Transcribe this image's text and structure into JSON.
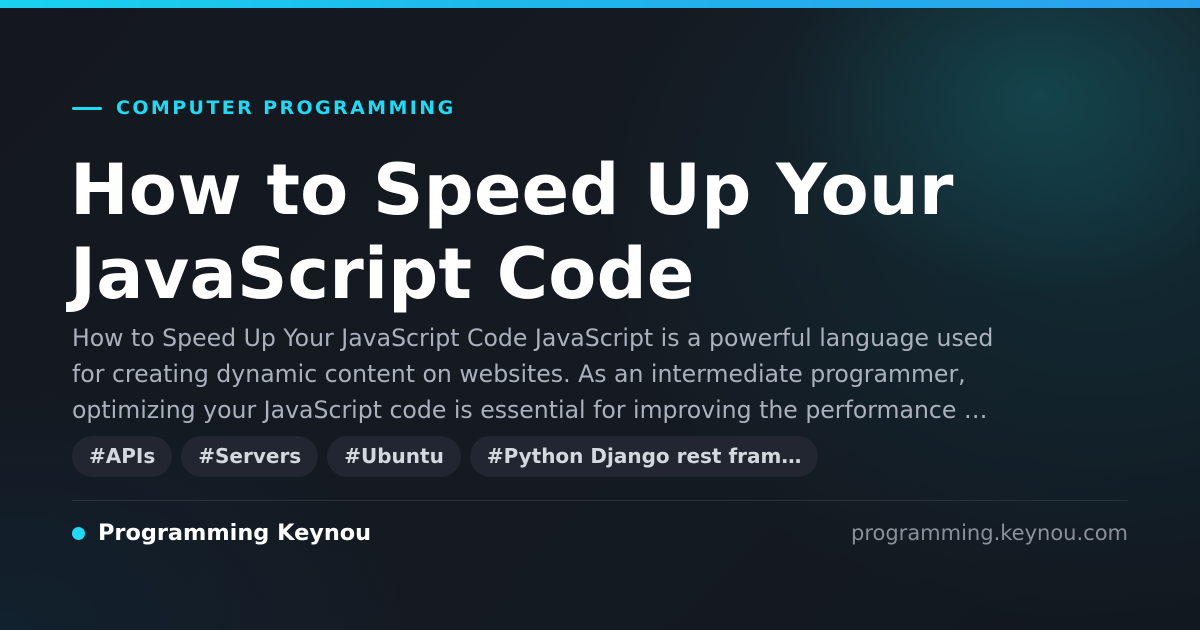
{
  "category": {
    "label": "COMPUTER PROGRAMMING"
  },
  "article": {
    "title": "How to Speed Up Your JavaScript Code",
    "excerpt": "How to Speed Up Your JavaScript Code JavaScript is a powerful language used\nfor creating dynamic content on websites. As an intermediate programmer,\noptimizing your JavaScript code is essential for improving the performance …"
  },
  "tags": [
    "#APIs",
    "#Servers",
    "#Ubuntu",
    "#Python Django rest fram…"
  ],
  "footer": {
    "brand_name": "Programming Keynou",
    "domain": "programming.keynou.com"
  },
  "colors": {
    "accent": "#22d8f2",
    "background": "#13161d",
    "tag_background": "#222630",
    "muted_text": "#aab1bd"
  }
}
